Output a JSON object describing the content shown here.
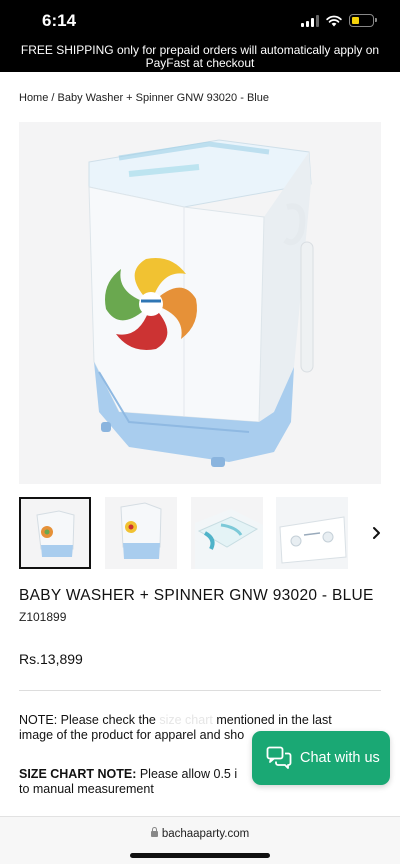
{
  "status_bar": {
    "time": "6:14"
  },
  "announcement": {
    "line1": "FREE SHIPPING only for prepaid orders will automatically apply on",
    "line2": "PayFast at checkout"
  },
  "breadcrumb": "Home / Baby Washer + Spinner GNW 93020 - Blue",
  "product": {
    "title": "BABY WASHER + SPINNER GNW 93020 - BLUE",
    "sku": "Z101899",
    "price": "Rs.13,899"
  },
  "thumbnails": [
    {
      "name": "thumb-front",
      "active": true
    },
    {
      "name": "thumb-front-2",
      "active": false
    },
    {
      "name": "thumb-lid-top",
      "active": false
    },
    {
      "name": "thumb-panel",
      "active": false
    }
  ],
  "notes": {
    "note_prefix": "NOTE: Please check the",
    "note_hidden": "size chart",
    "note_rest": "mentioned in the last",
    "note_line2": "image of the product for apparel and sho",
    "size_bold": "SIZE CHART NOTE:",
    "size_text": "Please allow 0.5 i",
    "size_line2": "to manual measurement"
  },
  "chat": {
    "label": "Chat with us"
  },
  "browser": {
    "url": "bachaaparty.com"
  },
  "colors": {
    "chat_green": "#1aa874",
    "machine_blue": "#a9cdee",
    "announce_bg": "#000000"
  }
}
